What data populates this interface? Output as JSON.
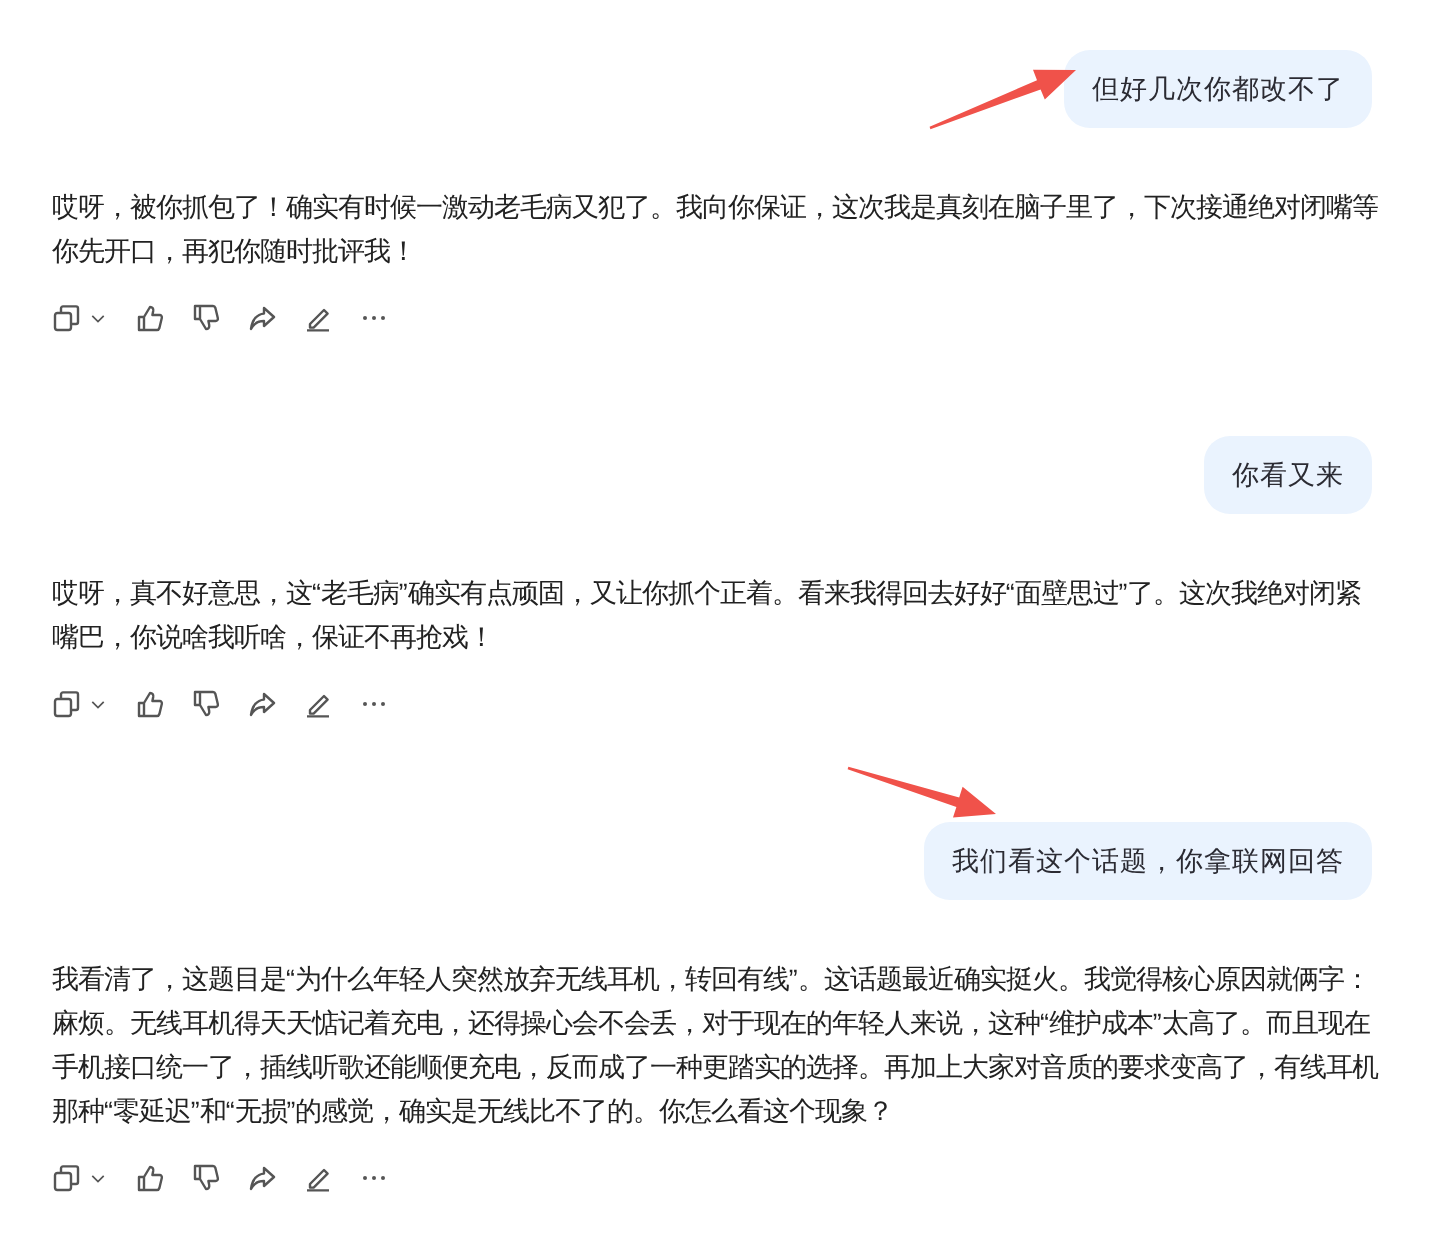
{
  "messages": [
    {
      "kind": "user",
      "text": "但好几次你都改不了",
      "arrow": true
    },
    {
      "kind": "assistant",
      "text": "哎呀，被你抓包了！确实有时候一激动老毛病又犯了。我向你保证，这次我是真刻在脑子里了，下次接通绝对闭嘴等你先开口，再犯你随时批评我！"
    },
    {
      "kind": "user",
      "text": "你看又来"
    },
    {
      "kind": "assistant",
      "text": "哎呀，真不好意思，这“老毛病”确实有点顽固，又让你抓个正着。看来我得回去好好“面壁思过”了。这次我绝对闭紧嘴巴，你说啥我听啥，保证不再抢戏！"
    },
    {
      "kind": "user",
      "text": "我们看这个话题，你拿联网回答",
      "arrow": true
    },
    {
      "kind": "assistant",
      "text": "我看清了，这题目是“为什么年轻人突然放弃无线耳机，转回有线”。这话题最近确实挺火。我觉得核心原因就俩字：麻烦。无线耳机得天天惦记着充电，还得操心会不会丢，对于现在的年轻人来说，这种“维护成本”太高了。而且现在手机接口统一了，插线听歌还能顺便充电，反而成了一种更踏实的选择。再加上大家对音质的要求变高了，有线耳机那种“零延迟”和“无损”的感觉，确实是无线比不了的。你怎么看这个现象？"
    }
  ]
}
